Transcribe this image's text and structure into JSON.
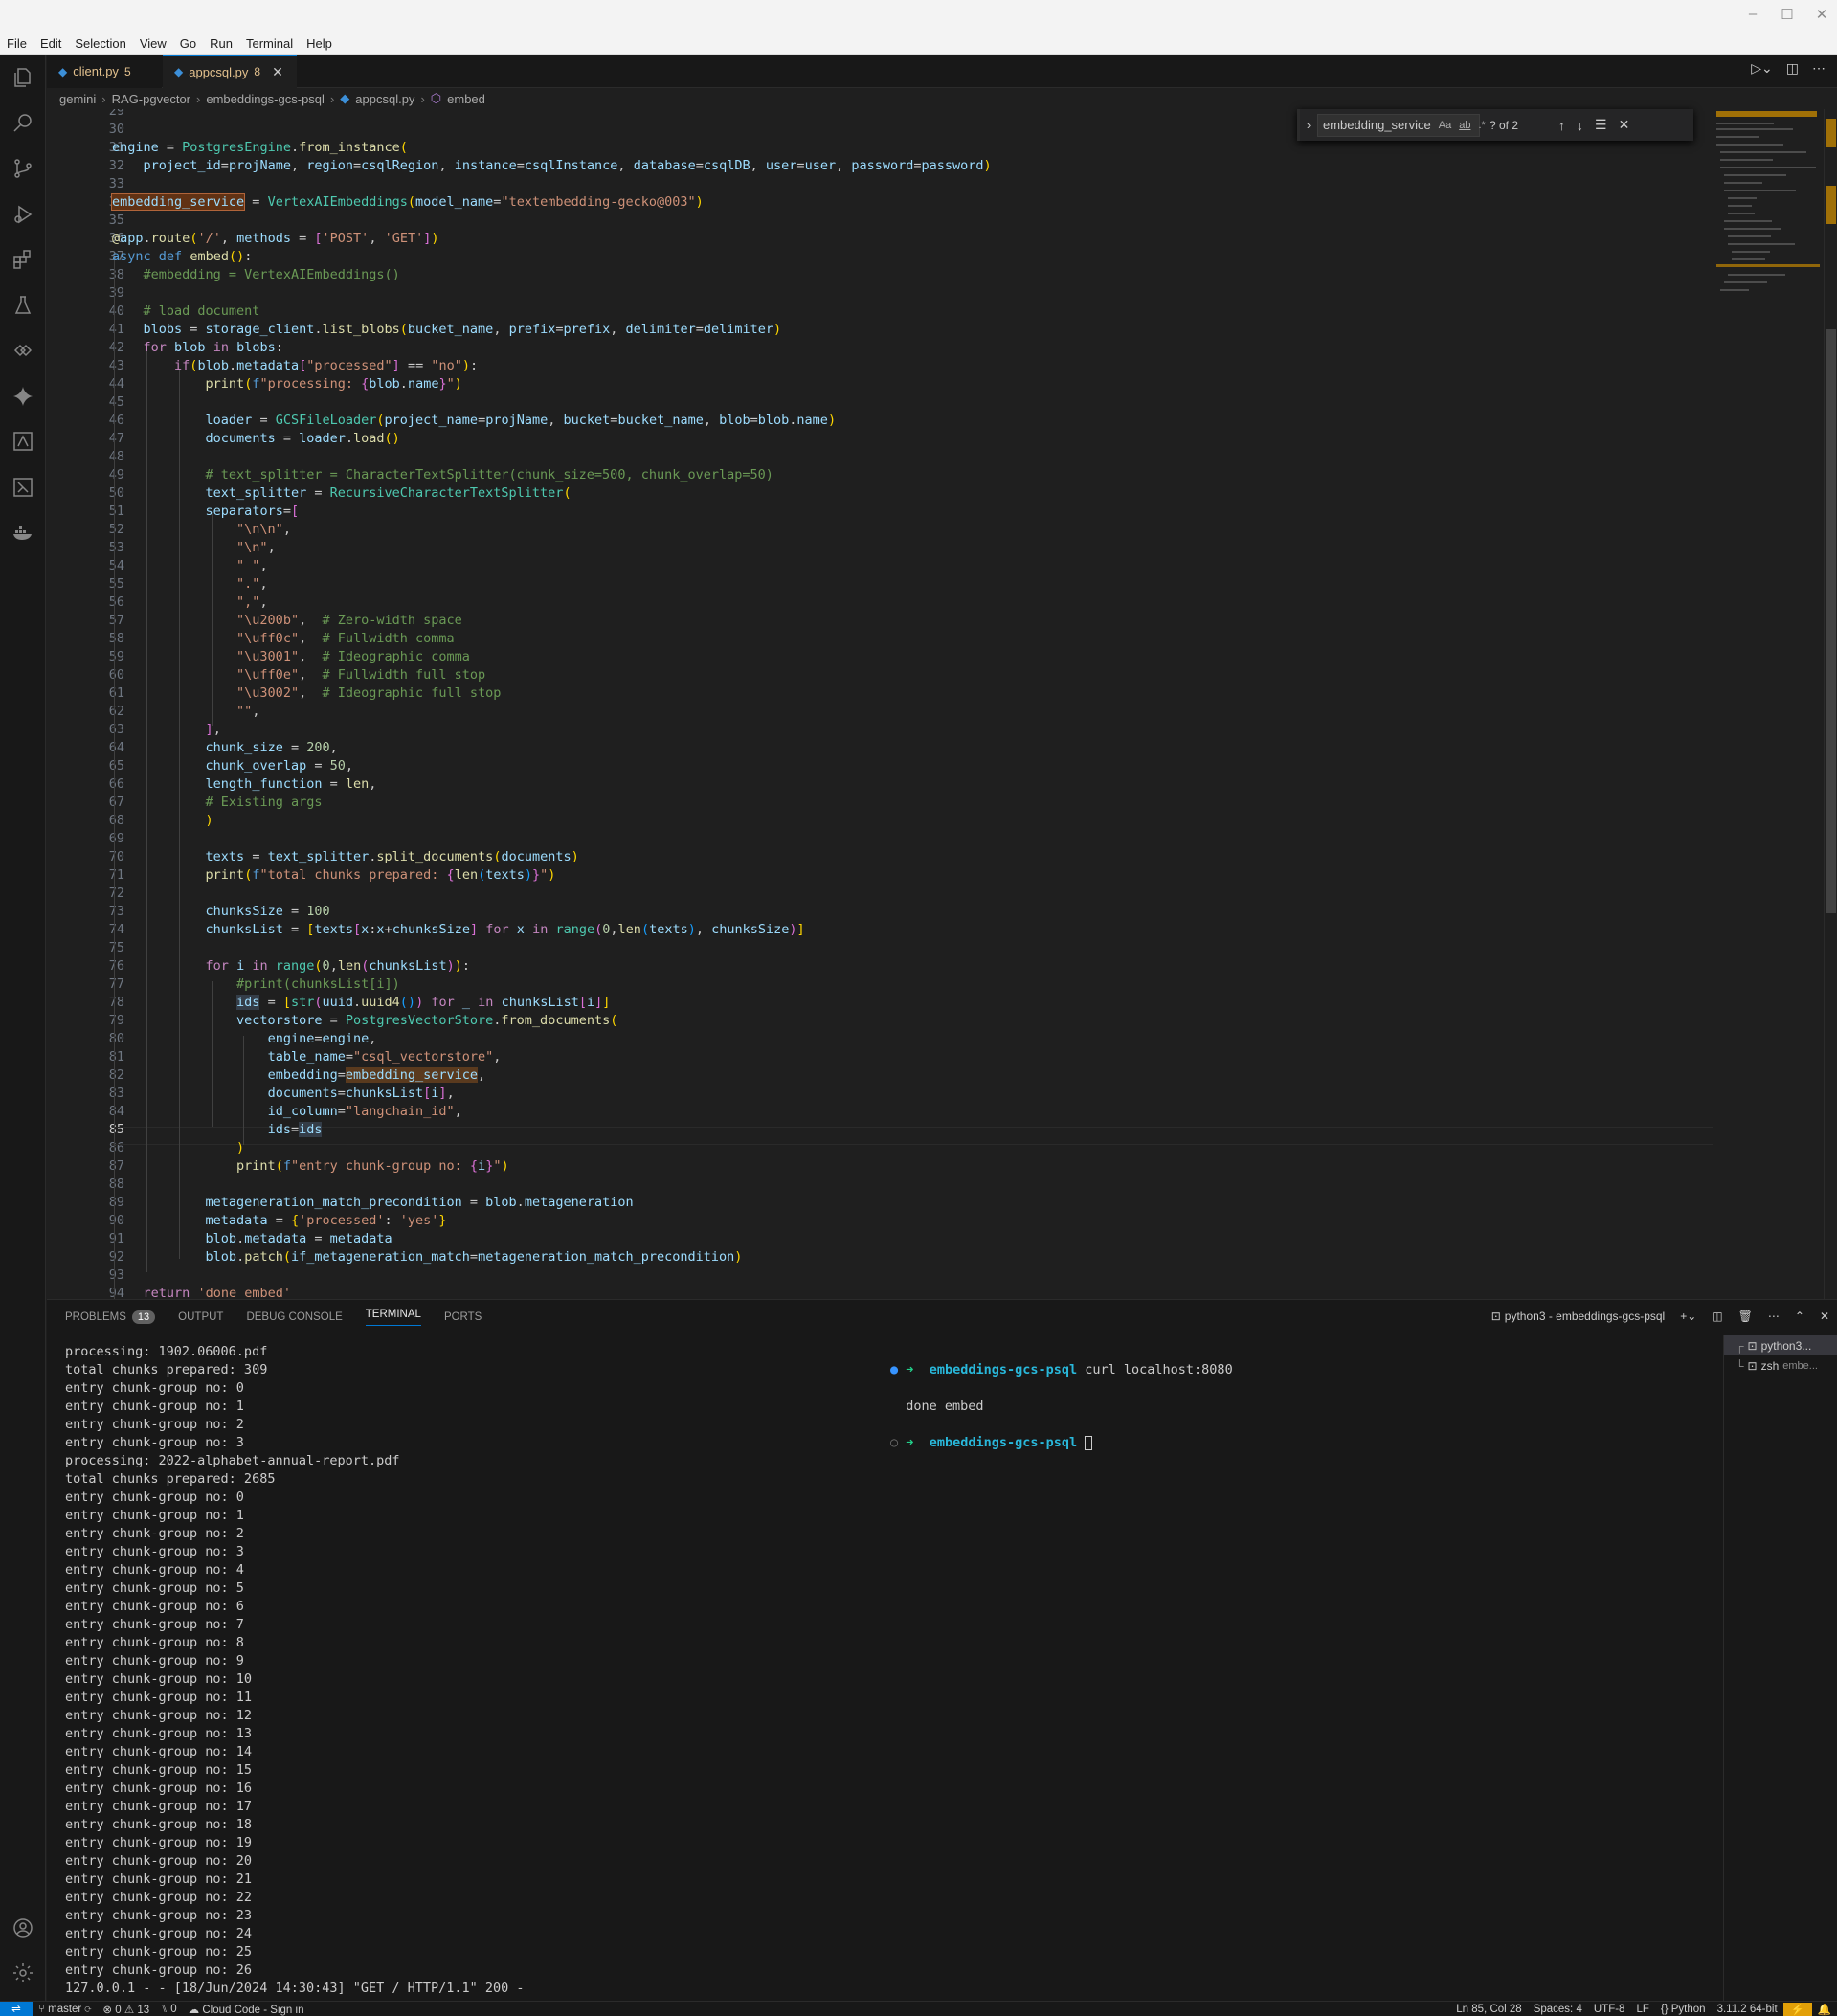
{
  "menu": [
    "File",
    "Edit",
    "Selection",
    "View",
    "Go",
    "Run",
    "Terminal",
    "Help"
  ],
  "window_controls": [
    "–",
    "☐",
    "✕"
  ],
  "tabs": [
    {
      "label": "client.py",
      "count": "5"
    },
    {
      "label": "appcsql.py",
      "count": "8"
    }
  ],
  "breadcrumb": [
    "gemini",
    "RAG-pgvector",
    "embeddings-gcs-psql",
    "appcsql.py",
    "embed"
  ],
  "find": {
    "query": "embedding_service",
    "result": "? of 2",
    "opt_case": "Aa",
    "opt_word": "ab",
    "opt_regex": ".*"
  },
  "editor": {
    "line_numbers": [
      "29",
      "30",
      "31",
      "32",
      "33",
      "34",
      "35",
      "36",
      "37",
      "38",
      "39",
      "40",
      "41",
      "42",
      "43",
      "44",
      "45",
      "46",
      "47",
      "48",
      "49",
      "50",
      "51",
      "52",
      "53",
      "54",
      "55",
      "56",
      "57",
      "58",
      "59",
      "60",
      "61",
      "62",
      "63",
      "64",
      "65",
      "66",
      "67",
      "68",
      "69",
      "70",
      "71",
      "72",
      "73",
      "74",
      "75",
      "76",
      "77",
      "78",
      "79",
      "80",
      "81",
      "82",
      "83",
      "84",
      "85",
      "86",
      "87",
      "88",
      "89",
      "90",
      "91",
      "92",
      "93",
      "94"
    ],
    "current_line": "85"
  },
  "panel": {
    "tabs": [
      "PROBLEMS",
      "OUTPUT",
      "DEBUG CONSOLE",
      "TERMINAL",
      "PORTS"
    ],
    "problems_count": "13",
    "terminal_title": "python3 - embeddings-gcs-psql"
  },
  "terminal_left": [
    "processing: 1902.06006.pdf",
    "total chunks prepared: 309",
    "entry chunk-group no: 0",
    "entry chunk-group no: 1",
    "entry chunk-group no: 2",
    "entry chunk-group no: 3",
    "processing: 2022-alphabet-annual-report.pdf",
    "total chunks prepared: 2685",
    "entry chunk-group no: 0",
    "entry chunk-group no: 1",
    "entry chunk-group no: 2",
    "entry chunk-group no: 3",
    "entry chunk-group no: 4",
    "entry chunk-group no: 5",
    "entry chunk-group no: 6",
    "entry chunk-group no: 7",
    "entry chunk-group no: 8",
    "entry chunk-group no: 9",
    "entry chunk-group no: 10",
    "entry chunk-group no: 11",
    "entry chunk-group no: 12",
    "entry chunk-group no: 13",
    "entry chunk-group no: 14",
    "entry chunk-group no: 15",
    "entry chunk-group no: 16",
    "entry chunk-group no: 17",
    "entry chunk-group no: 18",
    "entry chunk-group no: 19",
    "entry chunk-group no: 20",
    "entry chunk-group no: 21",
    "entry chunk-group no: 22",
    "entry chunk-group no: 23",
    "entry chunk-group no: 24",
    "entry chunk-group no: 25",
    "entry chunk-group no: 26",
    "127.0.0.1 - - [18/Jun/2024 14:30:43] \"GET / HTTP/1.1\" 200 -"
  ],
  "terminal_right": {
    "dir": "embeddings-gcs-psql",
    "command": "curl localhost:8080",
    "output": "done embed"
  },
  "terminal_list": [
    {
      "label": "python3..."
    },
    {
      "label": "zsh",
      "sub": "embe..."
    }
  ],
  "status": {
    "branch": "master",
    "errors": "0",
    "warnings": "13",
    "ports": "0",
    "cloud_code": "Cloud Code - Sign in",
    "position": "Ln 85, Col 28",
    "spaces": "Spaces: 4",
    "encoding": "UTF-8",
    "eol": "LF",
    "language": "Python",
    "interpreter": "3.11.2 64-bit"
  }
}
